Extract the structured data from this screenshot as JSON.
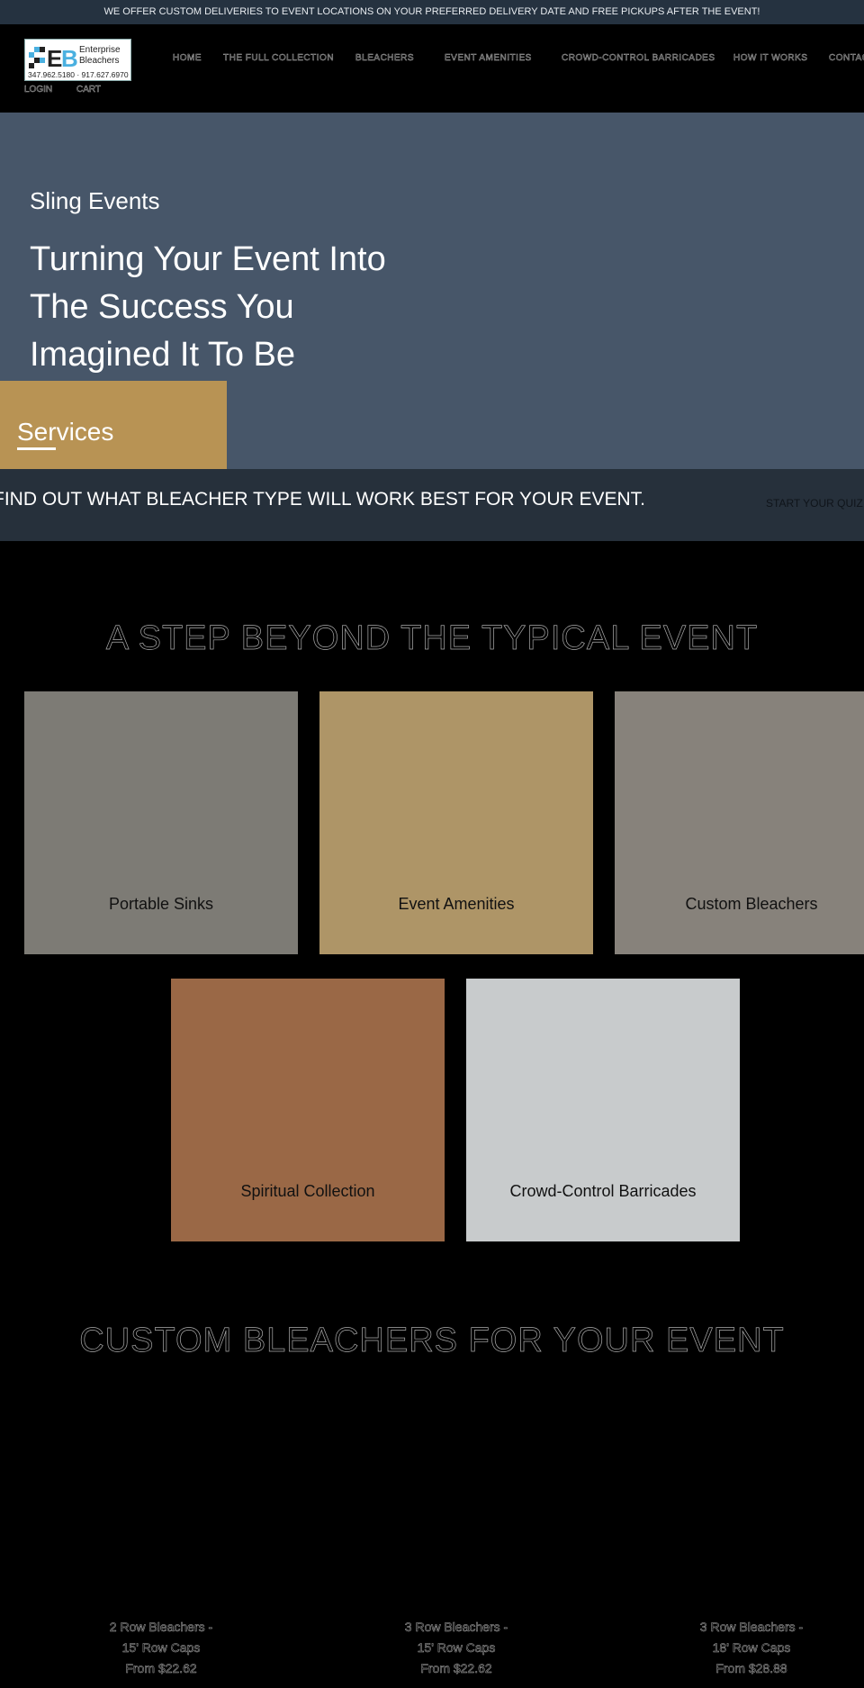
{
  "announcement": "WE OFFER CUSTOM DELIVERIES TO EVENT LOCATIONS ON YOUR PREFERRED DELIVERY DATE AND FREE PICKUPS AFTER THE EVENT!",
  "logo": {
    "name": "Enterprise Bleachers",
    "phones": "347.962.5180 · 917.627.6970"
  },
  "nav": [
    "HOME",
    "THE FULL COLLECTION",
    "BLEACHERS",
    "EVENT AMENITIES",
    "CROWD-CONTROL BARRICADES",
    "HOW IT WORKS",
    "CONTACT"
  ],
  "account": {
    "login": "LOGIN",
    "cart": "CART"
  },
  "hero": {
    "eyebrow": "Sling Events",
    "lines": [
      "Turning Your Event Into",
      "The Success You",
      "Imagined It To Be"
    ],
    "services": "Services"
  },
  "quiz": {
    "text": "FIND OUT WHAT BLEACHER TYPE WILL WORK BEST FOR YOUR EVENT.",
    "button": "START YOUR QUIZ"
  },
  "section1": {
    "title": "A STEP BEYOND THE TYPICAL EVENT",
    "cards": [
      {
        "label": "Portable Sinks",
        "color": "#7d7b75"
      },
      {
        "label": "Event Amenities",
        "color": "#ae9567"
      },
      {
        "label": "Custom Bleachers",
        "color": "#87827b"
      },
      {
        "label": "Spiritual Collection",
        "color": "#9a6846"
      },
      {
        "label": "Crowd-Control Barricades",
        "color": "#c8cbcc"
      }
    ]
  },
  "section2": {
    "title": "CUSTOM BLEACHERS FOR YOUR EVENT",
    "products": [
      {
        "name": "2 Row Bleachers -",
        "size": "15' Row Caps",
        "price": "From $22.62"
      },
      {
        "name": "3 Row Bleachers -",
        "size": "15' Row Caps",
        "price": "From $22.62"
      },
      {
        "name": "3 Row Bleachers -",
        "size": "18' Row Caps",
        "price": "From $28.88"
      }
    ]
  }
}
